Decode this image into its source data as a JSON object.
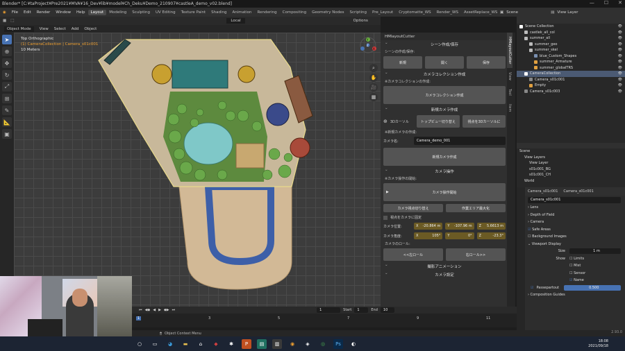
{
  "titlebar": {
    "text": "Blender* [C:¥taProject¥Pre2021¥MVA¥16_Dev¥lib¥model¥Ch_Deku¥Demo_210907¥castleA_demo_v02.blend]"
  },
  "menu": {
    "items": [
      "File",
      "Edit",
      "Render",
      "Window",
      "Help"
    ],
    "workspaces": [
      "Layout",
      "Modeling",
      "Sculpting",
      "UV Editing",
      "Texture Paint",
      "Shading",
      "Animation",
      "Rendering",
      "Compositing",
      "Geometry Nodes",
      "Scripting",
      "Pre_Layout",
      "Cryptomatte_WS",
      "Render_WS",
      "AssetReplace_WS"
    ],
    "scene": "Scene",
    "view_layer": "View Layer"
  },
  "vp_header": {
    "mode": "Object Mode",
    "menus": [
      "View",
      "Select",
      "Add",
      "Object"
    ],
    "orientation": "Local",
    "options": "Options"
  },
  "vp_info": {
    "line1": "Top Orthographic",
    "line2": "(1) CameraCollection | Camera_s01c001",
    "line3": "10 Meters"
  },
  "gizmo": {
    "x": "X",
    "y": "Y",
    "z": "Z"
  },
  "ntabs": [
    "HMlayoutCutter",
    "View",
    "Tool",
    "Item"
  ],
  "panel": {
    "title": "HMlayoutCutter",
    "s1": "シーン作成/保存",
    "s1_label": "シーンの作成/保存:",
    "b_new": "新規",
    "b_open": "開く",
    "b_save": "保存",
    "s2": "カメラコレクション作成",
    "s2_label": "※カメラコレクションの作成:",
    "b_cc": "カメラコレクション作成",
    "s3": "新規カメラ作成",
    "cursor3d": "3Dカーソル",
    "b_topview": "トップビュー切り替え",
    "b_viewto3d": "視点を3Dカーソルに",
    "s3_label": "※新規カメラの作成:",
    "camname_label": "カメラ名:",
    "camname_value": "Camera_demo_001",
    "b_newcam": "新規カメラ作成",
    "s4": "カメラ操作",
    "s4_label": "※カメラ操作の開始:",
    "b_camop": "カメラ操作開始",
    "b_camview": "カメラ視点切り替え",
    "b_area": "作業エリア最大化",
    "lock_label": "視点をカメラに固定",
    "pos_label": "カメラ位置:",
    "pos_x": "-20.864 m",
    "pos_y": "-107.96 m",
    "pos_z": "5.6613 m",
    "rot_label": "カメラ角度:",
    "rot_x": "105°",
    "rot_y": "0°",
    "rot_z": "-23.3°",
    "roll_label": "カメラのロール:",
    "b_rollL": "<<左ロール",
    "b_rollR": "右ロール>>",
    "s5": "撮影アニメーション",
    "s6": "カメラ設定"
  },
  "outliner": {
    "rows": [
      {
        "label": "Scene Collection",
        "ind": 0,
        "color": "#ffffff"
      },
      {
        "label": "castlek_all_col",
        "ind": 1,
        "color": "#bbbbbb"
      },
      {
        "label": "summer_all",
        "ind": 1,
        "color": "#bbbbbb"
      },
      {
        "label": "summer_geo",
        "ind": 2,
        "color": "#bbbbbb"
      },
      {
        "label": "summer_skel",
        "ind": 2,
        "color": "#bbbbbb"
      },
      {
        "label": "blue_Custom_Shapes",
        "ind": 3,
        "color": "#7a8fb0"
      },
      {
        "label": "summer_Armature",
        "ind": 3,
        "color": "#e0a040"
      },
      {
        "label": "summer_globalTRS",
        "ind": 3,
        "color": "#e0a040"
      },
      {
        "label": "CameraCollection",
        "ind": 1,
        "color": "#ffffff",
        "sel": true
      },
      {
        "label": "Camera_s01c001",
        "ind": 2,
        "color": "#888888"
      },
      {
        "label": "Empty",
        "ind": 2,
        "color": "#e0a040"
      },
      {
        "label": "Camera_s01c003",
        "ind": 1,
        "color": "#888888"
      }
    ]
  },
  "viewlayer": {
    "rows": [
      {
        "label": "Scene",
        "ind": 0
      },
      {
        "label": "View Layers",
        "ind": 1
      },
      {
        "label": "View Layer",
        "ind": 2
      },
      {
        "label": "s01c001_BG",
        "ind": 2
      },
      {
        "label": "s01c001_CH",
        "ind": 2
      },
      {
        "label": "World",
        "ind": 1
      }
    ]
  },
  "props": {
    "obj1": "Camera_s01c001",
    "obj2": "Camera_s01c001",
    "data": "Camera_s01c001",
    "rows": [
      "Lens",
      "Depth of Field",
      "Camera",
      "Safe Areas",
      "Background Images",
      "Viewport Display"
    ],
    "size_label": "Size",
    "size_value": "1 m",
    "show_label": "Show",
    "limits": "Limits",
    "mist": "Mist",
    "sensor": "Sensor",
    "name": "Name",
    "passepartout": "Passepartout",
    "pp_value": "0.500",
    "guides": "Composition Guides"
  },
  "timeline": {
    "frame": "1",
    "start_label": "Start",
    "start": "1",
    "end_label": "End",
    "end": "10",
    "ticks": [
      "1",
      "3",
      "5",
      "7",
      "9",
      "11"
    ]
  },
  "status": {
    "text": "Object Context Menu",
    "version": "2.93.0"
  },
  "taskbar": {
    "time": "18:08",
    "date": "2021/09/18"
  }
}
